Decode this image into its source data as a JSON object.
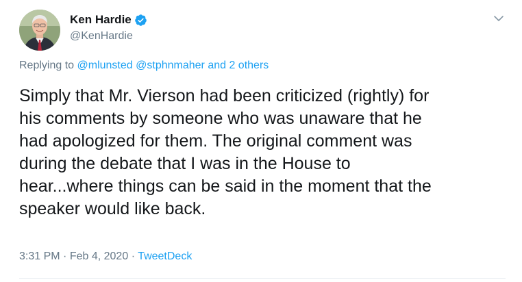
{
  "author": {
    "display_name": "Ken Hardie",
    "handle": "@KenHardie",
    "verified": true
  },
  "reply": {
    "prefix": "Replying to",
    "mention1": "@mlunsted",
    "mention2": "@stphnmaher",
    "others": "and 2 others"
  },
  "tweet": {
    "lines": [
      "Simply that Mr. Vierson had been criticized (rightly) for",
      "his comments by someone who was unaware that he",
      "had apologized for them. The original comment was",
      "during the debate that I was in the House to",
      "hear...where things can be said in the moment that the",
      "speaker would like back."
    ]
  },
  "meta": {
    "time": "3:31 PM",
    "separator1": "·",
    "date": "Feb 4, 2020",
    "separator2": "·",
    "source": "TweetDeck"
  },
  "colors": {
    "link": "#1da1f2",
    "secondary": "#657786",
    "text": "#14171a",
    "divider": "#e6ecf0"
  },
  "icons": {
    "verified": "verified-badge-icon",
    "menu": "chevron-down-icon"
  }
}
